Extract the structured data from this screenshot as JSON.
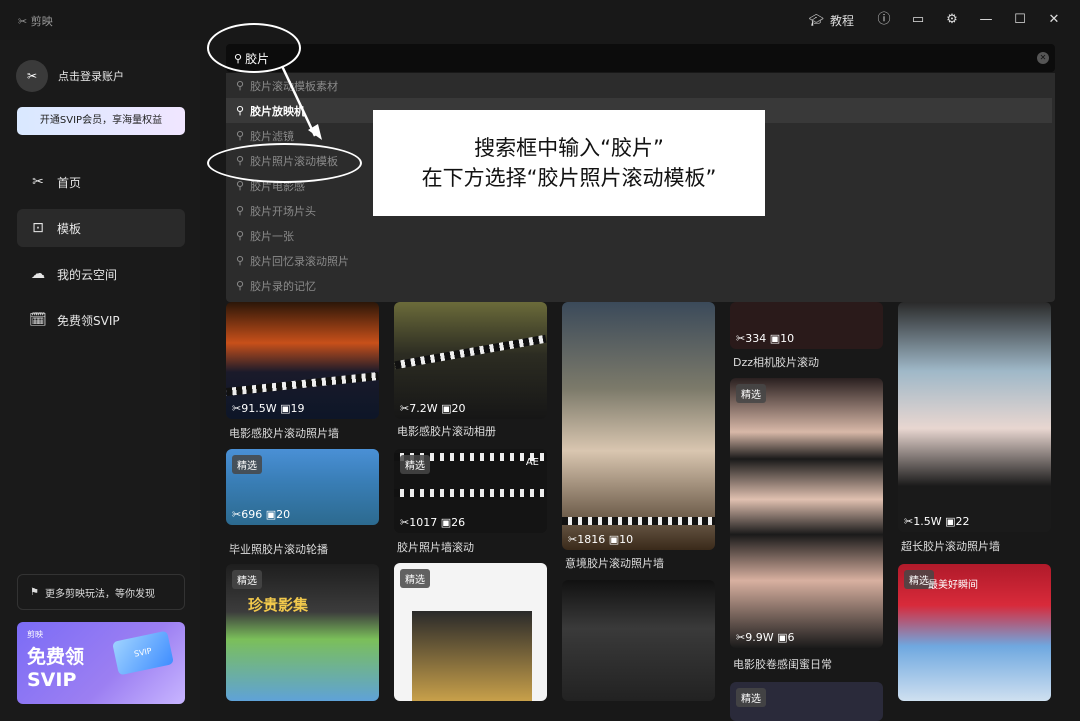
{
  "titlebar": {
    "app_name": "剪映",
    "tutorial_label": "教程"
  },
  "sidebar": {
    "login_label": "点击登录账户",
    "vip_button": "开通SVIP会员，享海量权益",
    "nav": [
      {
        "label": "首页",
        "icon": "scissors-icon"
      },
      {
        "label": "模板",
        "icon": "template-icon"
      },
      {
        "label": "我的云空间",
        "icon": "cloud-icon"
      },
      {
        "label": "免费领SVIP",
        "icon": "gift-icon"
      }
    ],
    "more_label": "更多剪映玩法，等你发现",
    "promo": {
      "brand": "剪映",
      "title": "免费领 SVIP",
      "card_label": "SVIP"
    }
  },
  "search": {
    "value": "胶片",
    "suggestions": [
      "胶片滚动模板素材",
      "胶片放映机",
      "胶片滤镜",
      "胶片照片滚动模板",
      "胶片电影感",
      "胶片开场片头",
      "胶片一张",
      "胶片回忆录滚动照片",
      "胶片录的记忆"
    ]
  },
  "callout": {
    "line1": "搜索框中输入“胶片”",
    "line2": "在下方选择“胶片照片滚动模板”"
  },
  "templates": [
    {
      "title": "电影感胶片滚动照片墙",
      "uses": "91.5W",
      "clips": "19",
      "badge": ""
    },
    {
      "title": "电影感胶片滚动相册",
      "uses": "7.2W",
      "clips": "20",
      "badge": ""
    },
    {
      "title": "意境胶片滚动照片墙",
      "uses": "1816",
      "clips": "10",
      "badge": ""
    },
    {
      "title": "Dzz相机胶片滚动",
      "uses": "334",
      "clips": "10",
      "badge": ""
    },
    {
      "title": "超长胶片滚动照片墙",
      "uses": "1.5W",
      "clips": "22",
      "badge": ""
    },
    {
      "title": "毕业照胶片滚动轮播",
      "uses": "696",
      "clips": "20",
      "badge": "精选"
    },
    {
      "title": "胶片照片墙滚动",
      "uses": "1017",
      "clips": "26",
      "badge": "精选"
    },
    {
      "title": "电影胶卷感闺蜜日常",
      "uses": "9.9W",
      "clips": "6",
      "badge": "精选"
    },
    {
      "title": "",
      "uses": "",
      "clips": "",
      "badge": "精选"
    },
    {
      "title": "",
      "uses": "",
      "clips": "",
      "badge": "精选"
    },
    {
      "title": "",
      "uses": "",
      "clips": "",
      "badge": "精选"
    },
    {
      "title": "",
      "uses": "",
      "clips": "",
      "badge": "精选"
    }
  ],
  "tile_text": {
    "t2_overlay": "AE",
    "t9_overlay": "珍贵影集",
    "t12_overlay": "最美好瞬间"
  },
  "icons": [
    "logo-icon",
    "graduation-cap-icon",
    "help-icon",
    "feedback-icon",
    "settings-icon",
    "minimize-icon",
    "maximize-icon",
    "close-icon",
    "search-icon"
  ]
}
